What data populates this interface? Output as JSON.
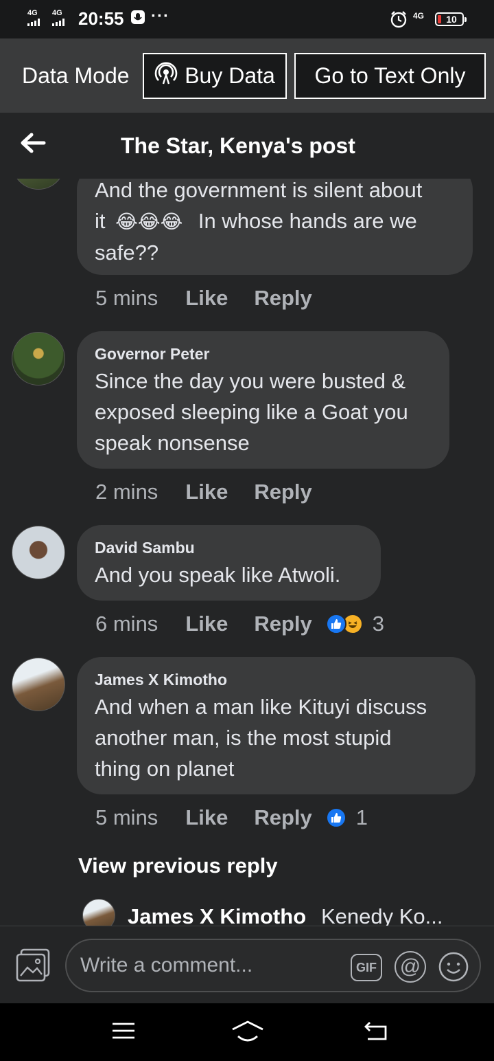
{
  "status_bar": {
    "signal_1": "4G",
    "signal_2": "4G",
    "time": "20:55",
    "overflow": "···",
    "network": "4G",
    "battery": "10",
    "icons": [
      "signal-icon",
      "voice-message-icon",
      "alarm-icon",
      "battery-icon"
    ]
  },
  "data_mode": {
    "label": "Data Mode",
    "buy_data": "Buy Data",
    "text_only": "Go to Text Only"
  },
  "header": {
    "title": "The Star, Kenya's post"
  },
  "comments": [
    {
      "author": "",
      "lines": [
        "And the government is silent about",
        "it",
        "In whose hands are we",
        "safe??"
      ],
      "emojis": [
        "😂",
        "😂",
        "😂"
      ],
      "time": "5 mins",
      "like": "Like",
      "reply": "Reply"
    },
    {
      "author": "Governor Peter",
      "lines": [
        "Since the day you were busted &",
        "exposed sleeping like a Goat you",
        "speak nonsense"
      ],
      "time": "2 mins",
      "like": "Like",
      "reply": "Reply"
    },
    {
      "author": "David Sambu",
      "lines": [
        "And you speak like Atwoli."
      ],
      "time": "6 mins",
      "like": "Like",
      "reply": "Reply",
      "reactions": {
        "types": [
          "like",
          "haha"
        ],
        "count": "3"
      }
    },
    {
      "author": "James X Kimotho",
      "lines": [
        "And when a man like Kituyi discuss",
        "another man, is the most stupid",
        "thing on planet"
      ],
      "time": "5 mins",
      "like": "Like",
      "reply": "Reply",
      "reactions": {
        "types": [
          "like"
        ],
        "count": "1"
      }
    }
  ],
  "view_previous": "View previous reply",
  "last_reply": {
    "author": "James X Kimotho",
    "snippet": "Kenedy Ko..."
  },
  "composer": {
    "placeholder": "Write a comment...",
    "gif": "GIF",
    "at": "@"
  },
  "colors": {
    "background": "#242526",
    "bubble": "#3a3b3c",
    "like_blue": "#1877f2",
    "haha_yellow": "#f7b125"
  }
}
